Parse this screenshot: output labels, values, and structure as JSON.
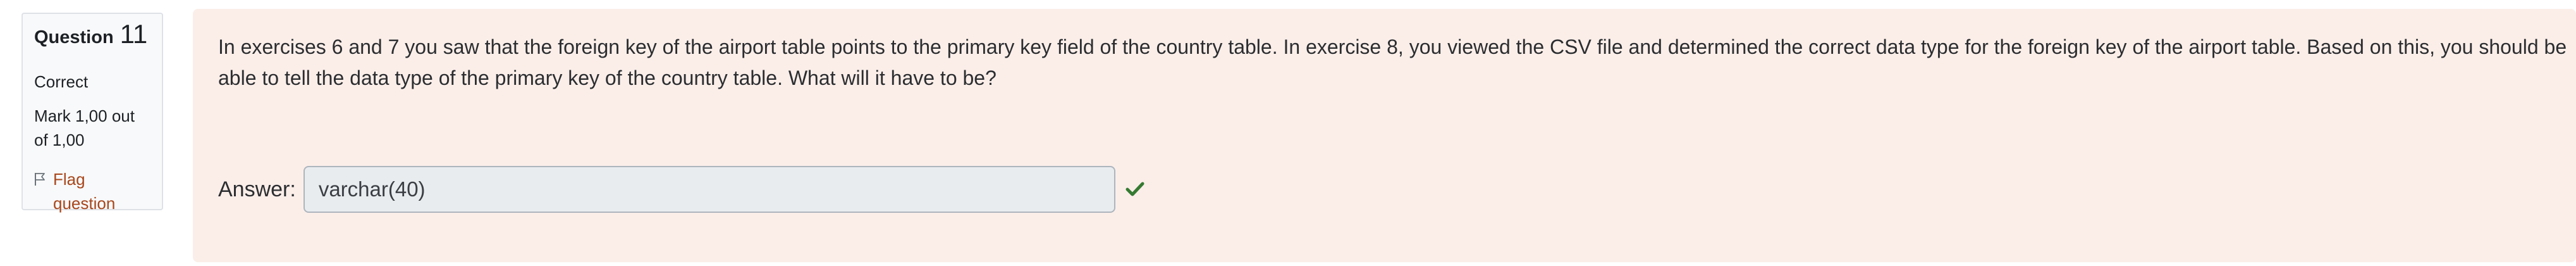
{
  "question_info": {
    "label": "Question",
    "number": "11",
    "state": "Correct",
    "grade": "Mark 1,00 out of 1,00",
    "flag_label": "Flag question",
    "flag_icon": "flag-outline-icon"
  },
  "question": {
    "text": "In exercises 6 and 7 you saw that the foreign key of the airport table points to the primary key field of the country table. In exercise 8, you viewed the CSV file and determined the correct data type for the foreign key of the airport table. Based on this, you should be able to tell the data type of the primary key of the country table. What will it have to be?",
    "answer_label": "Answer:",
    "answer_value": "varchar(40)",
    "result_icon": "checkmark-icon"
  },
  "colors": {
    "panel_background": "#fbeee9",
    "info_background": "#f8f9fa",
    "flag_link": "#a8471c",
    "correct_check": "#357a32"
  }
}
